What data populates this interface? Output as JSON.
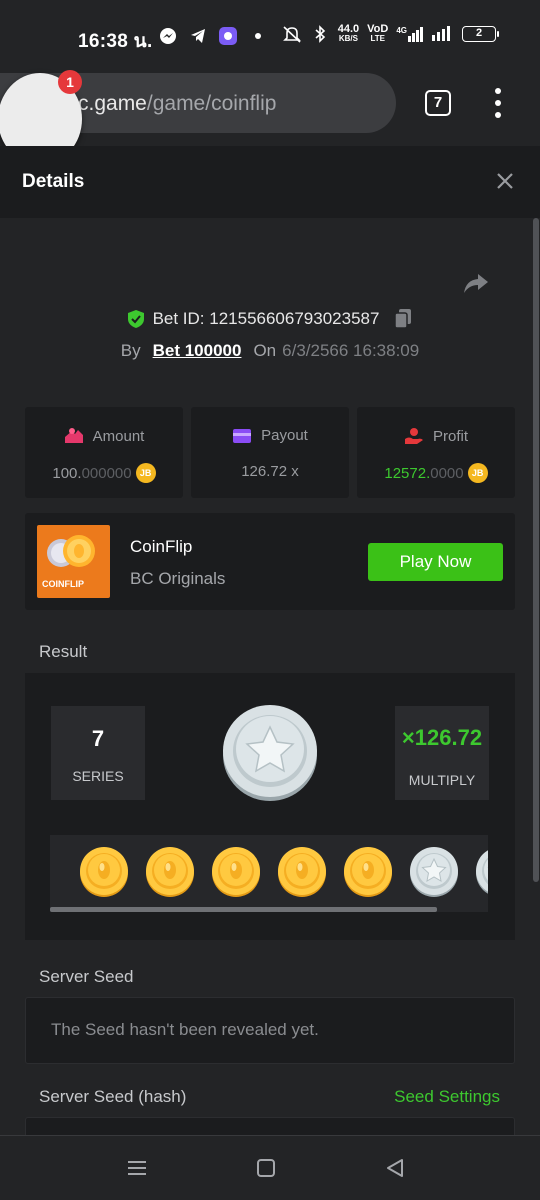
{
  "status_bar": {
    "time": "16:38 น.",
    "net_speed": "44.0",
    "net_unit": "KB/S",
    "vo_label": "VoD",
    "lte_label": "LTE",
    "signal_label": "4G",
    "battery": "2"
  },
  "browser": {
    "url_domain": "c.game",
    "url_path": "/game/coinflip",
    "tab_count": "7",
    "notification_count": "1"
  },
  "details": {
    "title": "Details"
  },
  "bet": {
    "id_label": "Bet ID: 121556606793023587",
    "by_label": "By",
    "user": "Bet 100000",
    "on_label": "On",
    "date": "6/3/2566 16:38:09"
  },
  "stats": {
    "amount_label": "Amount",
    "amount_main": "100.",
    "amount_dim": "000000",
    "payout_label": "Payout",
    "payout_value": "126.72 x",
    "profit_label": "Profit",
    "profit_main": "12572.",
    "profit_dim": "0000",
    "coin_symbol": "JB"
  },
  "game": {
    "name": "CoinFlip",
    "provider": "BC Originals",
    "thumb_label": "COINFLIP",
    "play_label": "Play Now"
  },
  "result": {
    "label": "Result",
    "series_value": "7",
    "series_label": "SERIES",
    "multiply_value": "×126.72",
    "multiply_label": "MULTIPLY",
    "history": [
      "gold",
      "gold",
      "gold",
      "gold",
      "gold",
      "silver",
      "silver"
    ]
  },
  "seeds": {
    "server_seed_label": "Server Seed",
    "server_seed_value": "The Seed hasn't been revealed yet.",
    "server_seed_hash_label": "Server Seed (hash)",
    "settings_label": "Seed Settings"
  },
  "colors": {
    "accent_green": "#3bc117",
    "background": "#232426",
    "card": "#1b1c1e",
    "coin_gold": "#f5b820"
  },
  "icons": [
    "messenger-icon",
    "telegram-icon",
    "app-icon",
    "mute-icon",
    "bluetooth-icon",
    "signal-icon",
    "shield-check-icon",
    "copy-icon",
    "share-icon",
    "close-icon",
    "amount-icon",
    "wallet-icon",
    "profit-icon",
    "menu-icon",
    "home-icon",
    "back-icon"
  ]
}
